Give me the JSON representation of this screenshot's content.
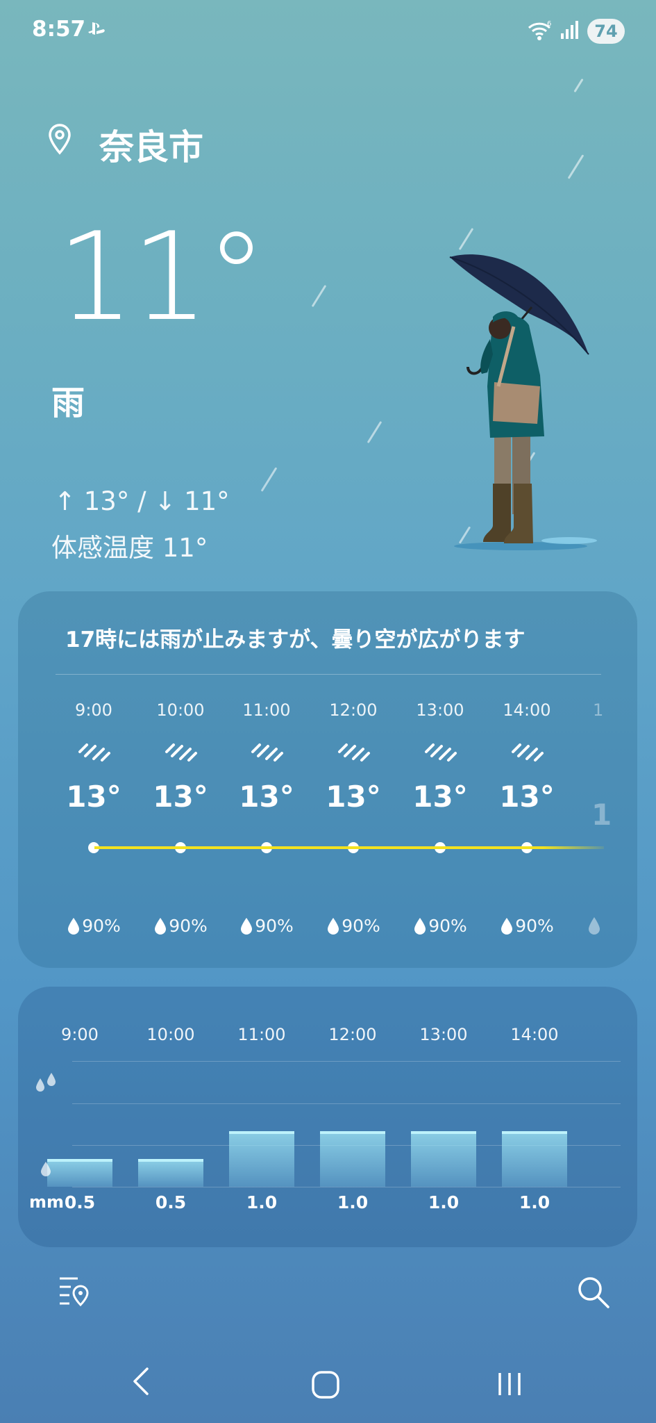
{
  "status_bar": {
    "time": "8:57",
    "battery": "74"
  },
  "header": {
    "city": "奈良市"
  },
  "current": {
    "temperature": "11°",
    "condition": "雨",
    "hi_lo": "↑ 13° / ↓ 11°",
    "feels_like": "体感温度 11°"
  },
  "hourly": {
    "summary": "17時には雨が止みますが、曇り空が広がります",
    "items": [
      {
        "time": "9:00",
        "temp": "13°",
        "precip": "90%"
      },
      {
        "time": "10:00",
        "temp": "13°",
        "precip": "90%"
      },
      {
        "time": "11:00",
        "temp": "13°",
        "precip": "90%"
      },
      {
        "time": "12:00",
        "temp": "13°",
        "precip": "90%"
      },
      {
        "time": "13:00",
        "temp": "13°",
        "precip": "90%"
      },
      {
        "time": "14:00",
        "temp": "13°",
        "precip": "90%"
      }
    ],
    "icon": "rain-icon"
  },
  "precipitation": {
    "unit": "mm",
    "times": [
      "9:00",
      "10:00",
      "11:00",
      "12:00",
      "13:00",
      "14:00"
    ],
    "labels": [
      "0.5",
      "0.5",
      "1.0",
      "1.0",
      "1.0",
      "1.0"
    ]
  },
  "chart_data": {
    "type": "bar",
    "categories": [
      "9:00",
      "10:00",
      "11:00",
      "12:00",
      "13:00",
      "14:00"
    ],
    "values": [
      0.5,
      0.5,
      1.0,
      1.0,
      1.0,
      1.0
    ],
    "ylabel": "mm"
  },
  "colors": {
    "temp_line": "#f3e21f",
    "bar_top": "#bdf2fb"
  }
}
